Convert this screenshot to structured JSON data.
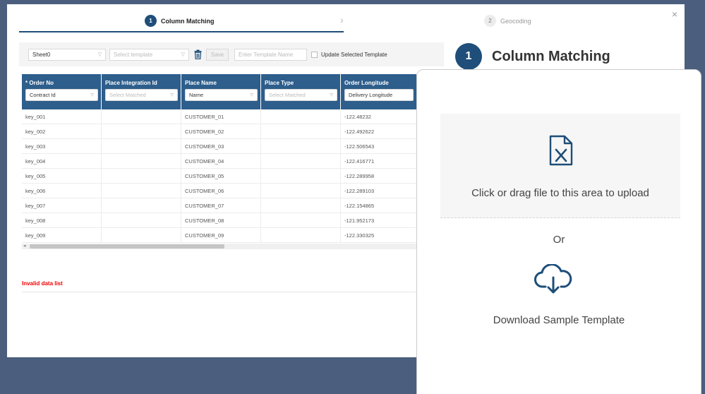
{
  "steps": [
    {
      "number": "1",
      "label": "Column Matching"
    },
    {
      "number": "2",
      "label": "Geocoding"
    }
  ],
  "close_label": "×",
  "toolbar": {
    "sheet": "Sheet0",
    "template_placeholder": "Select template",
    "save_label": "Save",
    "template_name_placeholder": "Enter Template Name",
    "update_label": "Update Selected Template"
  },
  "grid": {
    "columns": [
      {
        "header": "* Order No",
        "match": "Contract Id",
        "placeholder": false
      },
      {
        "header": "Place Integration Id",
        "match": "Select Matched",
        "placeholder": true
      },
      {
        "header": "Place Name",
        "match": "Name",
        "placeholder": false
      },
      {
        "header": "Place Type",
        "match": "Select Matched",
        "placeholder": true
      },
      {
        "header": "Order Longitude",
        "match": "Delivery Longitude",
        "placeholder": false
      }
    ],
    "rows": [
      [
        "key_001",
        "",
        "CUSTOMER_01",
        "",
        "-122.48232"
      ],
      [
        "key_002",
        "",
        "CUSTOMER_02",
        "",
        "-122.492622"
      ],
      [
        "key_003",
        "",
        "CUSTOMER_03",
        "",
        "-122.506543"
      ],
      [
        "key_004",
        "",
        "CUSTOMER_04",
        "",
        "-122.416771"
      ],
      [
        "key_005",
        "",
        "CUSTOMER_05",
        "",
        "-122.289958"
      ],
      [
        "key_006",
        "",
        "CUSTOMER_06",
        "",
        "-122.289103"
      ],
      [
        "key_007",
        "",
        "CUSTOMER_07",
        "",
        "-122.154865"
      ],
      [
        "key_008",
        "",
        "CUSTOMER_08",
        "",
        "-121.952173"
      ],
      [
        "key_009",
        "",
        "CUSTOMER_09",
        "",
        "-122.330325"
      ]
    ]
  },
  "invalid_label": "Invalid data list",
  "section_title": {
    "number": "1",
    "label": "Column Matching"
  },
  "upload": {
    "drop_text": "Click or drag file to this area to upload",
    "or_text": "Or",
    "download_text": "Download Sample Template"
  },
  "colors": {
    "primary": "#1e4e79",
    "header": "#2d5e8c",
    "error": "#e00000",
    "backdrop": "#4b5e7d"
  }
}
